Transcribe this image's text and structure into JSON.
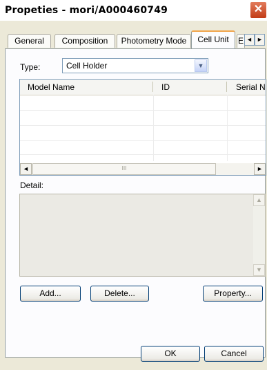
{
  "window": {
    "title": "Propeties - mori/A000460749",
    "close_glyph": "✕"
  },
  "tabs": [
    {
      "label": "General"
    },
    {
      "label": "Composition"
    },
    {
      "label": "Photometry Mode"
    },
    {
      "label": "Cell Unit"
    },
    {
      "label": "E"
    }
  ],
  "tab_scroll": {
    "left": "◄",
    "right": "►"
  },
  "type_field": {
    "label": "Type:",
    "value": "Cell Holder",
    "arrow": "▼"
  },
  "list": {
    "columns": [
      "Model Name",
      "ID",
      "Serial N"
    ],
    "scroll_left": "◄",
    "scroll_right": "►",
    "thumb_grip": "III"
  },
  "detail": {
    "label": "Detail:",
    "scroll_up": "▲",
    "scroll_down": "▼"
  },
  "buttons": {
    "add": "Add...",
    "delete": "Delete...",
    "property": "Property...",
    "ok": "OK",
    "cancel": "Cancel"
  },
  "colors": {
    "close": "#c23c16",
    "tab_highlight": "#f1a54b",
    "border": "#7f9db9"
  }
}
